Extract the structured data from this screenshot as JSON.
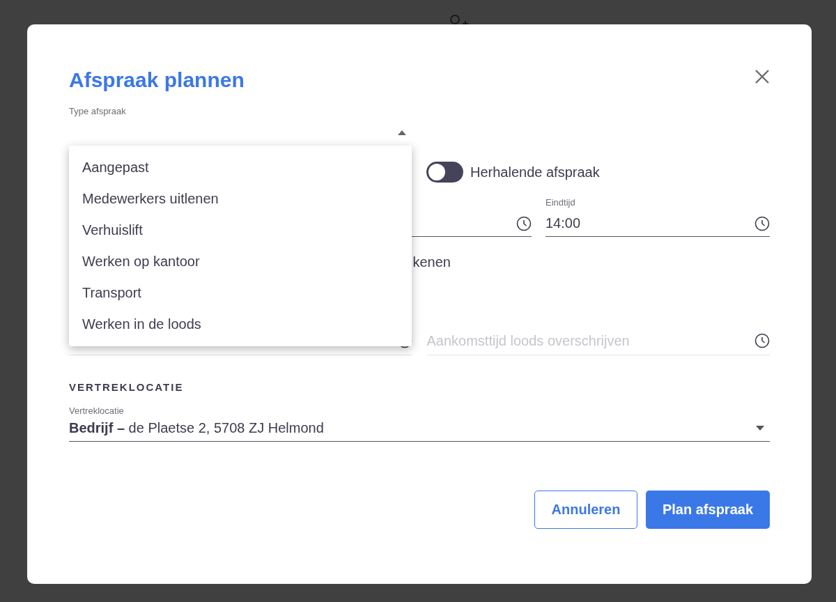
{
  "dialog": {
    "title": "Afspraak plannen"
  },
  "type_field": {
    "label": "Type afspraak",
    "expanded": true,
    "focused": true,
    "options": [
      {
        "label": "Aangepast",
        "selected": false
      },
      {
        "label": "Medewerkers uitlenen",
        "selected": false
      },
      {
        "label": "Verhuislift",
        "selected": false
      },
      {
        "label": "Werken op kantoor",
        "selected": false
      },
      {
        "label": "Transport",
        "selected": false
      },
      {
        "label": "Werken in de loods",
        "selected": false
      }
    ]
  },
  "recurring": {
    "label": "Herhalende afspraak",
    "on": false
  },
  "end_time": {
    "label": "Eindtijd",
    "value": "14:00"
  },
  "row_text": "kenen",
  "arrival_override": {
    "placeholder": "Aankomsttijd loods overschrijven"
  },
  "departure": {
    "heading": "VERTREKLOCATIE",
    "label": "Vertreklocatie",
    "value": "**Bedrijf –** de Plaetse 2, 5708 ZJ Helmond"
  },
  "buttons": [
    {
      "label": "Annuleren",
      "kind": "secondary"
    },
    {
      "label": "Plan afspraak",
      "kind": "primary"
    }
  ]
}
